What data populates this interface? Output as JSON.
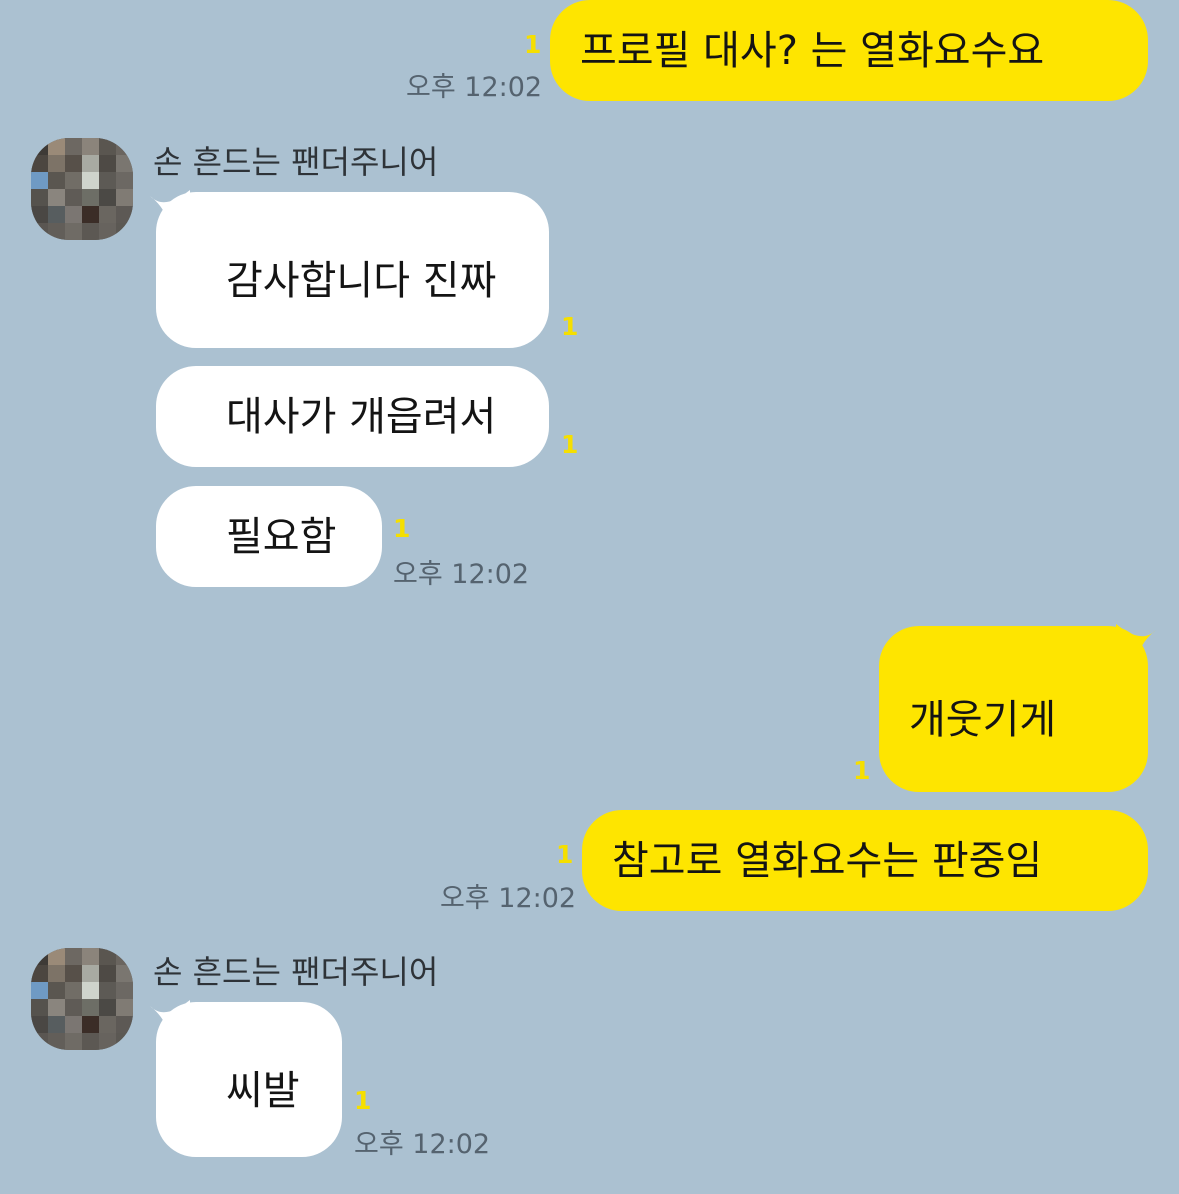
{
  "chat": {
    "sender_name": "손 흔드는 팬더주니어",
    "unread_count": "1",
    "messages": [
      {
        "text": "프로필 대사? 는 열화요수요",
        "time": "오후 12:02"
      },
      {
        "text": "감사합니다 진짜"
      },
      {
        "text": "대사가 개읍려서"
      },
      {
        "text": "필요함",
        "time": "오후 12:02"
      },
      {
        "text": "개웃기게"
      },
      {
        "text": "참고로 열화요수는 판중임",
        "time": "오후 12:02"
      },
      {
        "text": "씨발",
        "time": "오후 12:02"
      }
    ]
  },
  "avatar_pixel_colors": [
    "#3e3a36",
    "#9a8a78",
    "#6d6862",
    "#8b847b",
    "#5a5650",
    "#6a655f",
    "#4c4640",
    "#7d7367",
    "#575049",
    "#a8aaa2",
    "#4e4a45",
    "#7a7670",
    "#6f9ac4",
    "#5a5650",
    "#716d66",
    "#cfd4cc",
    "#5d5a55",
    "#6c6863",
    "#55524d",
    "#8a857e",
    "#5f5b56",
    "#6d6e66",
    "#4b4945",
    "#807b74",
    "#4a4744",
    "#575d5f",
    "#7b7672",
    "#3b2d27",
    "#6a6660",
    "#5d5955",
    "#5a5652",
    "#625e59",
    "#6f6b65",
    "#5c5853",
    "#67635e",
    "#5b5853"
  ]
}
